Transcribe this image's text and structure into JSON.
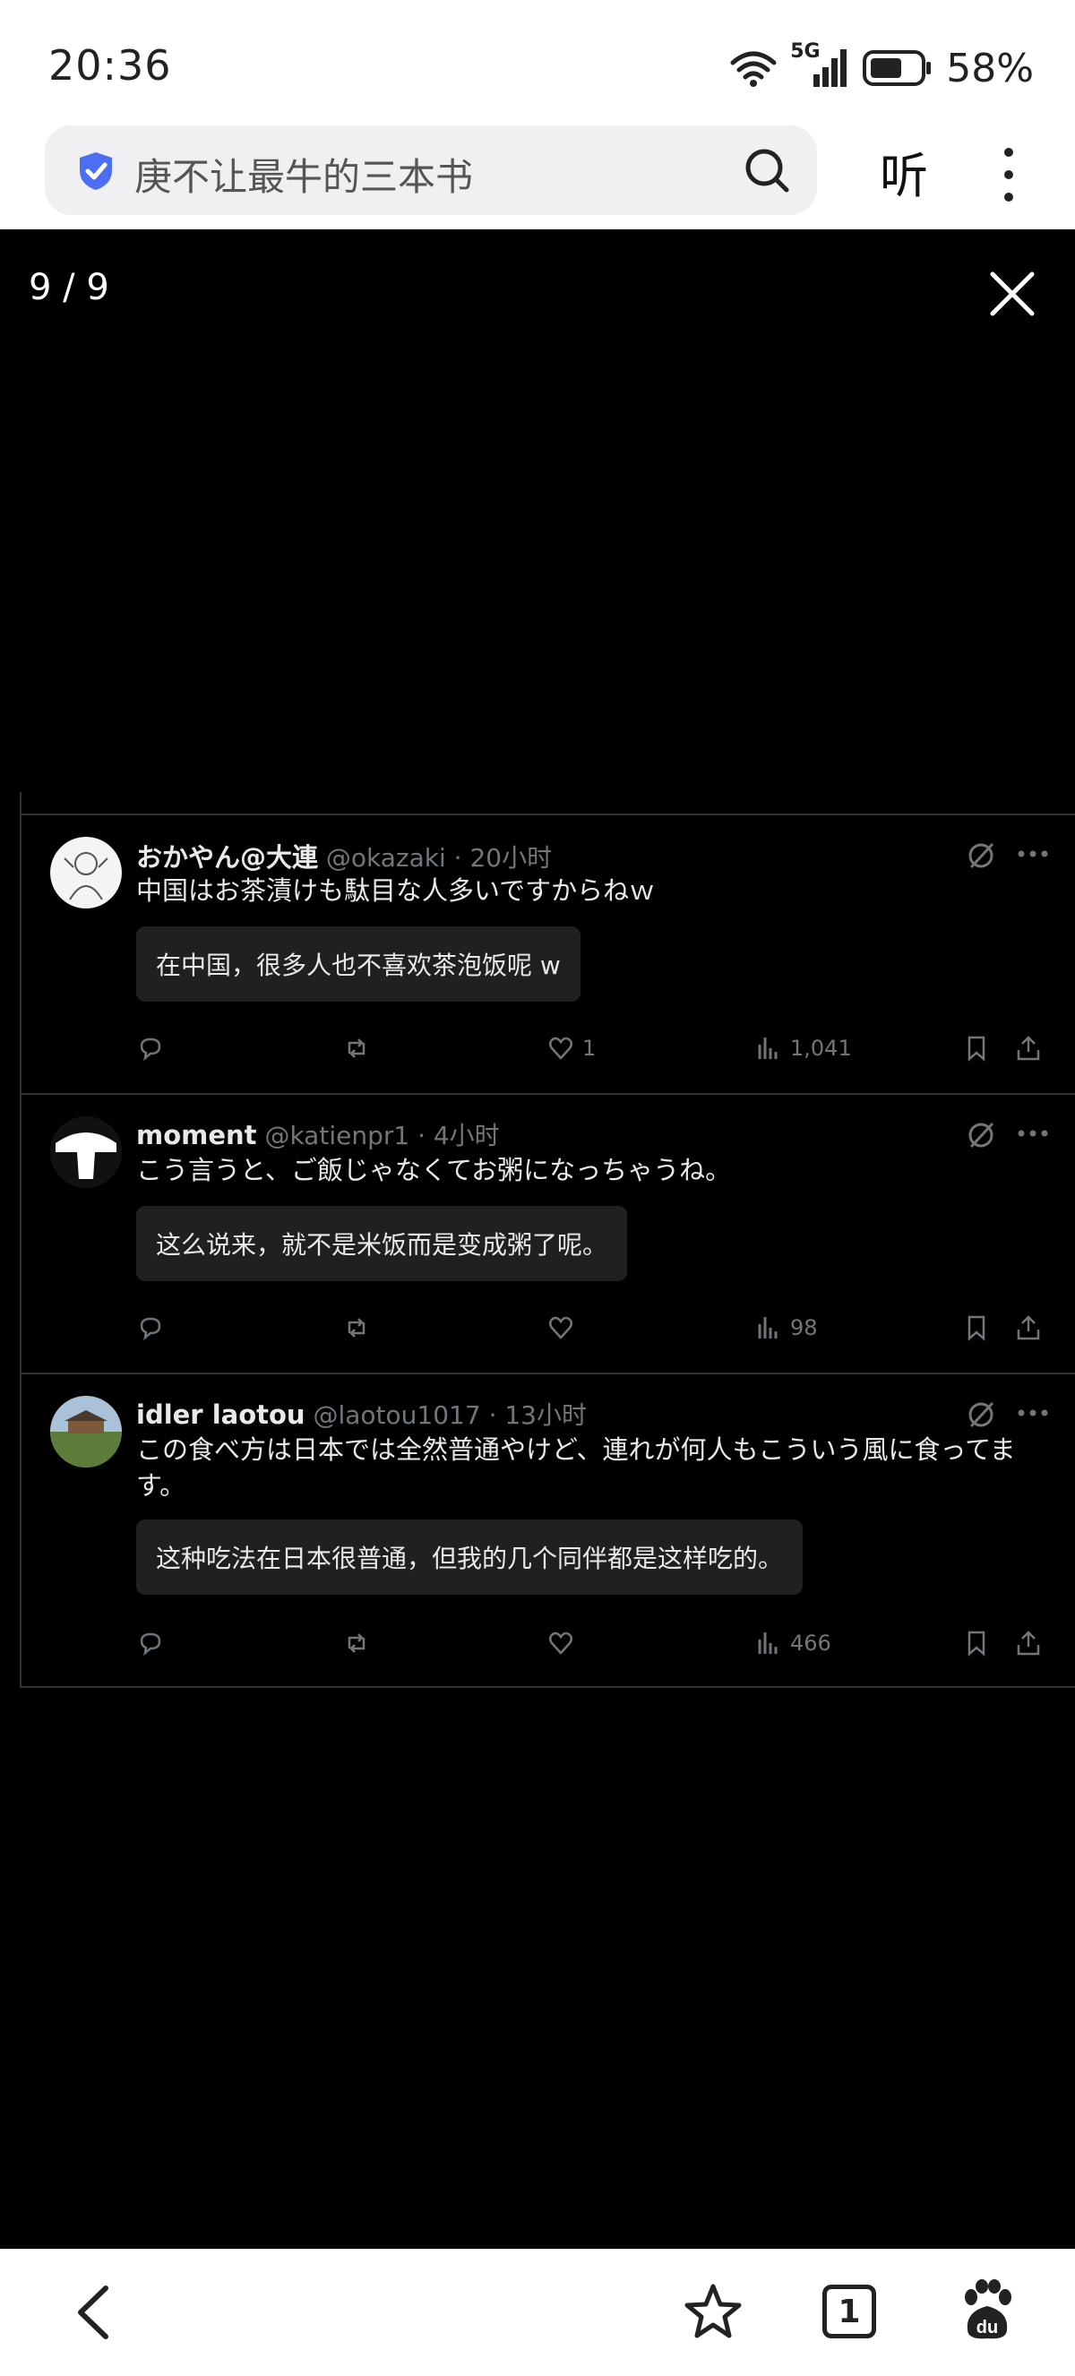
{
  "status_bar": {
    "time": "20:36",
    "network": "5G",
    "battery": "58%",
    "icons": [
      "wifi-icon",
      "signal-icon",
      "battery-icon"
    ]
  },
  "browser": {
    "search_text": "庚不让最牛的三本书",
    "listen_label": "听"
  },
  "viewer": {
    "counter": "9 / 9"
  },
  "tweets": [
    {
      "name": "おかやん@大連",
      "handle": "@okazaki · 20小时",
      "text": "中国はお茶漬けも駄目な人多いですからねｗ",
      "translation": "在中国，很多人也不喜欢茶泡饭呢 w",
      "likes": "1",
      "views": "1,041"
    },
    {
      "name": "moment",
      "handle": "@katienpr1 · 4小时",
      "text": "こう言うと、ご飯じゃなくてお粥になっちゃうね。",
      "translation": "这么说来，就不是米饭而是变成粥了呢。",
      "likes": "",
      "views": "98"
    },
    {
      "name": "idler laotou",
      "handle": "@laotou1017 · 13小时",
      "text": "この食べ方は日本では全然普通やけど、連れが何人もこういう風に食ってます。",
      "translation": "这种吃法在日本很普通，但我的几个同伴都是这样吃的。",
      "likes": "",
      "views": "466"
    }
  ],
  "bottom_nav": {
    "tabs_count": "1"
  },
  "colors": {
    "accent_shield": "#4c6ef5",
    "tweet_text": "#e7e9ea",
    "tweet_muted": "#71767b",
    "divider": "#2f3336"
  }
}
